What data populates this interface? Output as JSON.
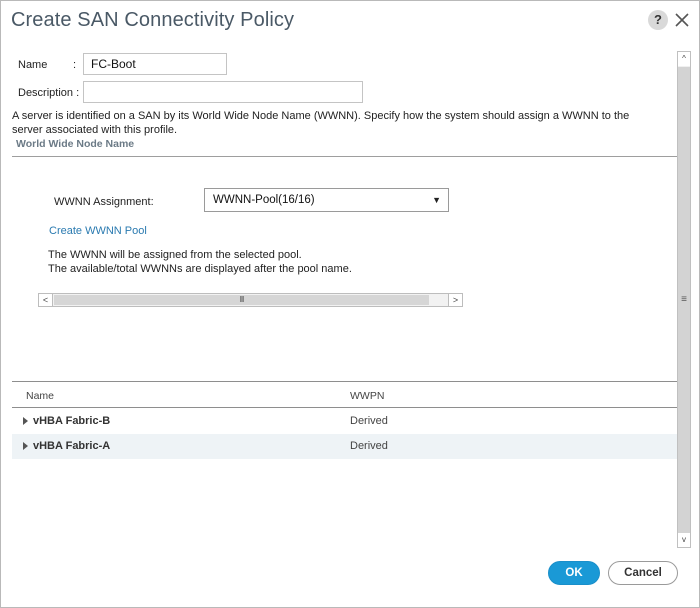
{
  "dialog": {
    "title": "Create SAN Connectivity Policy",
    "help_label": "?",
    "ok_label": "OK",
    "cancel_label": "Cancel"
  },
  "form": {
    "name_label": "Name",
    "name_sep": ":",
    "name_value": "FC-Boot",
    "description_label": "Description :",
    "description_value": "",
    "info_text": "A server is identified on a SAN by its World Wide Node Name (WWNN). Specify how the system should assign a WWNN to the server associated with this profile.",
    "section_title": "World Wide Node Name",
    "wwnn_label": "WWNN Assignment:",
    "wwnn_selected": "WWNN-Pool(16/16)",
    "create_pool_link": "Create WWNN Pool",
    "note_line1": "The WWNN will be assigned from the selected pool.",
    "note_line2": "The available/total WWNNs are displayed after the pool name."
  },
  "icons": {
    "select_arrow": "▼",
    "scroll_left": "<",
    "scroll_right": ">",
    "scroll_grip": "III",
    "scroll_up": "^",
    "scroll_down": "v",
    "vscroll_grip": "≡"
  },
  "table": {
    "columns": [
      "Name",
      "WWPN"
    ],
    "rows": [
      {
        "name": "vHBA Fabric-B",
        "wwpn": "Derived"
      },
      {
        "name": "vHBA Fabric-A",
        "wwpn": "Derived"
      }
    ]
  },
  "colors": {
    "title": "#4a5966",
    "link": "#2a7ab0",
    "ok_button": "#1a99d6",
    "row_alt": "#eef3f6"
  }
}
